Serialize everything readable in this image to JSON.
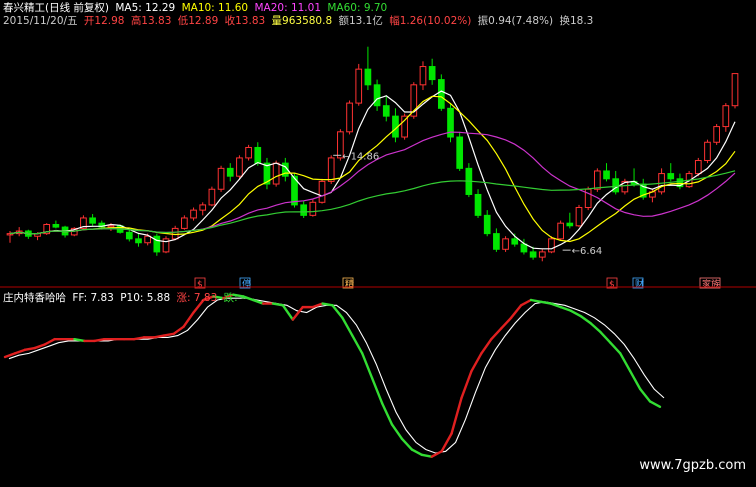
{
  "header": {
    "stock_name": "春兴精工(日线 前复权)",
    "ma5_label": "MA5: 12.29",
    "ma10_label": "MA10: 11.60",
    "ma20_label": "MA20: 11.01",
    "ma60_label": "MA60: 9.70",
    "colors": {
      "stock": "#ffffff",
      "ma5": "#ffffff",
      "ma10": "#ffff00",
      "ma20": "#ff00ff",
      "ma60": "#00ff00"
    }
  },
  "bar_info": {
    "date": "2015/11/20/五",
    "open": "开12.98",
    "high": "高13.83",
    "low": "低12.89",
    "close": "收13.83",
    "volume": "量963580.8",
    "amount": "额13.1亿",
    "change": "幅1.26(10.02%)",
    "amplitude": "振0.94(7.48%)",
    "turnover": "换18.3"
  },
  "indicator": {
    "name": "庄内特香哈哈",
    "ff_label": "FF: 7.83",
    "p10_label": "P10: 5.88",
    "up_label": "涨: 7.83",
    "down_label": "跌: -"
  },
  "watermark": "www.7gpzb.com",
  "event_markers": [
    "$",
    "停",
    "精",
    "$",
    "财",
    "家族"
  ],
  "colors": {
    "background": "#000000",
    "up_candle": "#ff3232",
    "down_candle": "#00e600",
    "ma5": "#ffffff",
    "ma10": "#ffff00",
    "ma20": "#cc33cc",
    "ma60": "#33cc33",
    "osc_rising": "#e02020",
    "osc_falling": "#33dd33",
    "osc_signal": "#ffffff",
    "divider": "#b00000"
  },
  "chart_data": [
    {
      "type": "candlestick",
      "title": "春兴精工(日线 前复权)",
      "annotations": [
        {
          "label": "14.86",
          "x_index": 35
        },
        {
          "label": "6.64",
          "x_index": 60
        }
      ],
      "ylim": [
        6.0,
        15.5
      ],
      "candles": [
        [
          7.65,
          7.8,
          7.35,
          7.7
        ],
        [
          7.7,
          7.95,
          7.6,
          7.8
        ],
        [
          7.8,
          7.85,
          7.5,
          7.6
        ],
        [
          7.6,
          7.75,
          7.45,
          7.7
        ],
        [
          7.7,
          8.1,
          7.65,
          8.05
        ],
        [
          8.05,
          8.2,
          7.9,
          7.95
        ],
        [
          7.95,
          8.0,
          7.55,
          7.65
        ],
        [
          7.65,
          7.95,
          7.6,
          7.9
        ],
        [
          7.9,
          8.4,
          7.85,
          8.3
        ],
        [
          8.3,
          8.45,
          8.0,
          8.1
        ],
        [
          8.1,
          8.2,
          7.85,
          7.95
        ],
        [
          7.95,
          8.1,
          7.8,
          8.0
        ],
        [
          8.0,
          8.05,
          7.7,
          7.75
        ],
        [
          7.75,
          7.9,
          7.4,
          7.5
        ],
        [
          7.5,
          7.7,
          7.2,
          7.35
        ],
        [
          7.35,
          7.7,
          7.25,
          7.6
        ],
        [
          7.6,
          7.7,
          6.85,
          7.0
        ],
        [
          7.0,
          7.6,
          6.95,
          7.5
        ],
        [
          7.5,
          8.0,
          7.45,
          7.9
        ],
        [
          7.9,
          8.4,
          7.85,
          8.3
        ],
        [
          8.3,
          8.7,
          8.2,
          8.6
        ],
        [
          8.6,
          8.9,
          8.4,
          8.8
        ],
        [
          8.8,
          9.5,
          8.75,
          9.4
        ],
        [
          9.4,
          10.3,
          9.3,
          10.2
        ],
        [
          10.2,
          10.4,
          9.7,
          9.9
        ],
        [
          9.9,
          10.7,
          9.8,
          10.6
        ],
        [
          10.6,
          11.1,
          10.5,
          11.0
        ],
        [
          11.0,
          11.2,
          10.3,
          10.4
        ],
        [
          10.4,
          10.6,
          9.4,
          9.6
        ],
        [
          9.6,
          10.5,
          9.5,
          10.4
        ],
        [
          10.4,
          10.6,
          9.7,
          9.9
        ],
        [
          9.9,
          10.0,
          8.7,
          8.8
        ],
        [
          8.8,
          8.95,
          8.3,
          8.4
        ],
        [
          8.4,
          9.0,
          8.35,
          8.9
        ],
        [
          8.9,
          9.8,
          8.85,
          9.7
        ],
        [
          9.7,
          10.7,
          9.6,
          10.6
        ],
        [
          10.6,
          11.7,
          10.5,
          11.6
        ],
        [
          11.6,
          12.8,
          11.5,
          12.7
        ],
        [
          12.7,
          14.2,
          12.6,
          14.0
        ],
        [
          14.0,
          14.86,
          13.2,
          13.4
        ],
        [
          13.4,
          13.6,
          12.4,
          12.6
        ],
        [
          12.6,
          13.0,
          12.0,
          12.2
        ],
        [
          12.2,
          12.5,
          11.2,
          11.4
        ],
        [
          11.4,
          12.3,
          11.3,
          12.2
        ],
        [
          12.2,
          13.5,
          12.1,
          13.4
        ],
        [
          13.4,
          14.3,
          13.2,
          14.1
        ],
        [
          14.1,
          14.4,
          13.4,
          13.6
        ],
        [
          13.6,
          13.8,
          12.4,
          12.5
        ],
        [
          12.5,
          12.7,
          11.2,
          11.4
        ],
        [
          11.4,
          11.6,
          10.1,
          10.2
        ],
        [
          10.2,
          10.4,
          9.1,
          9.2
        ],
        [
          9.2,
          9.4,
          8.3,
          8.4
        ],
        [
          8.4,
          8.6,
          7.6,
          7.7
        ],
        [
          7.7,
          7.9,
          7.0,
          7.1
        ],
        [
          7.1,
          7.6,
          7.0,
          7.5
        ],
        [
          7.5,
          7.7,
          7.2,
          7.3
        ],
        [
          7.3,
          7.5,
          6.9,
          7.0
        ],
        [
          7.0,
          7.2,
          6.7,
          6.8
        ],
        [
          6.8,
          7.1,
          6.64,
          7.0
        ],
        [
          7.0,
          7.6,
          6.95,
          7.5
        ],
        [
          7.5,
          8.2,
          7.45,
          8.1
        ],
        [
          8.1,
          8.5,
          7.9,
          8.0
        ],
        [
          8.0,
          8.8,
          7.95,
          8.7
        ],
        [
          8.7,
          9.5,
          8.6,
          9.4
        ],
        [
          9.4,
          10.2,
          9.3,
          10.1
        ],
        [
          10.1,
          10.4,
          9.7,
          9.8
        ],
        [
          9.8,
          10.1,
          9.2,
          9.3
        ],
        [
          9.3,
          9.8,
          9.2,
          9.7
        ],
        [
          9.7,
          10.2,
          9.5,
          9.6
        ],
        [
          9.6,
          9.8,
          9.0,
          9.1
        ],
        [
          9.1,
          9.4,
          8.9,
          9.3
        ],
        [
          9.3,
          10.2,
          9.2,
          10.0
        ],
        [
          10.0,
          10.4,
          9.7,
          9.8
        ],
        [
          9.8,
          10.0,
          9.4,
          9.5
        ],
        [
          9.5,
          10.1,
          9.45,
          10.0
        ],
        [
          10.0,
          10.6,
          9.9,
          10.5
        ],
        [
          10.5,
          11.3,
          10.4,
          11.2
        ],
        [
          11.2,
          11.9,
          11.1,
          11.8
        ],
        [
          11.8,
          12.7,
          11.6,
          12.6
        ],
        [
          12.6,
          13.83,
          12.5,
          13.83
        ]
      ]
    },
    {
      "type": "line",
      "title": "庄内特香哈哈",
      "ylim": [
        0,
        10
      ],
      "series": [
        {
          "name": "FF",
          "values": [
            6.8,
            7.0,
            7.2,
            7.3,
            7.5,
            7.8,
            7.8,
            7.8,
            7.7,
            7.7,
            7.8,
            7.8,
            7.8,
            7.8,
            7.9,
            7.9,
            8.0,
            8.1,
            8.5,
            9.3,
            10.0,
            10.2,
            10.1,
            10.3,
            10.2,
            10.0,
            9.8,
            9.8,
            9.7,
            8.9,
            9.6,
            9.6,
            9.8,
            9.7,
            9.0,
            8.0,
            7.0,
            5.6,
            4.2,
            3.0,
            2.2,
            1.6,
            1.3,
            1.2,
            1.5,
            2.5,
            4.5,
            6.0,
            7.0,
            7.8,
            8.4,
            9.0,
            9.7,
            10.0,
            9.9,
            9.8,
            9.6,
            9.4,
            9.1,
            8.7,
            8.2,
            7.6,
            7.0,
            6.0,
            5.0,
            4.3,
            4.0
          ]
        },
        {
          "name": "P10",
          "values": [
            6.7,
            6.9,
            7.0,
            7.2,
            7.4,
            7.6,
            7.7,
            7.7,
            7.7,
            7.7,
            7.7,
            7.8,
            7.8,
            7.8,
            7.8,
            7.9,
            7.9,
            8.0,
            8.3,
            8.9,
            9.6,
            10.0,
            10.1,
            10.1,
            10.1,
            10.0,
            9.9,
            9.8,
            9.7,
            9.4,
            9.3,
            9.6,
            9.7,
            9.7,
            9.3,
            8.6,
            7.6,
            6.4,
            5.0,
            3.7,
            2.7,
            2.0,
            1.6,
            1.4,
            1.5,
            2.0,
            3.3,
            4.8,
            6.2,
            7.2,
            8.0,
            8.7,
            9.3,
            9.8,
            9.9,
            9.8,
            9.7,
            9.5,
            9.3,
            9.0,
            8.6,
            8.1,
            7.5,
            6.7,
            5.8,
            5.0,
            4.5
          ]
        }
      ]
    }
  ]
}
